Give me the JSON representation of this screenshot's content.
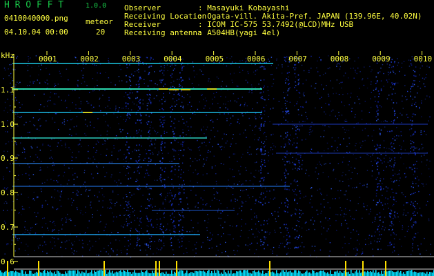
{
  "app": {
    "title": "H R O F F T",
    "version": "1.0.0"
  },
  "file": {
    "name": "0410040000.png",
    "datetime": "04.10.04 00:00"
  },
  "meteor": {
    "label": "meteor",
    "count": "20"
  },
  "info": {
    "observer_label": "Observer",
    "observer_value": ": Masayuki Kobayashi",
    "location_label": "Receiving Location",
    "location_value": ": Ogata-vill. Akita-Pref. JAPAN (139.96E, 40.02N)",
    "receiver_label": "Receiver",
    "receiver_value": ": ICOM IC-575 53.7492(@LCD)MHz USB",
    "antenna_label": "Receiving antenna",
    "antenna_value": ": A504HB(yagi 4el)"
  },
  "spectrogram": {
    "unit_label": "kHz",
    "freq_ticks": [
      "1.1",
      "1.0",
      "0.9",
      "0.8",
      "0.7",
      "0.6"
    ],
    "time_labels": [
      "0001",
      "0002",
      "0003",
      "0004",
      "0005",
      "0006",
      "0007",
      "0008",
      "0009",
      "0010"
    ],
    "colors": {
      "background": "#000000",
      "noise": "#1428c8",
      "carrier": "#00c8ff",
      "hot": "#ffe000",
      "axis": "#ffff40",
      "histogram": "#00e0ff"
    }
  }
}
